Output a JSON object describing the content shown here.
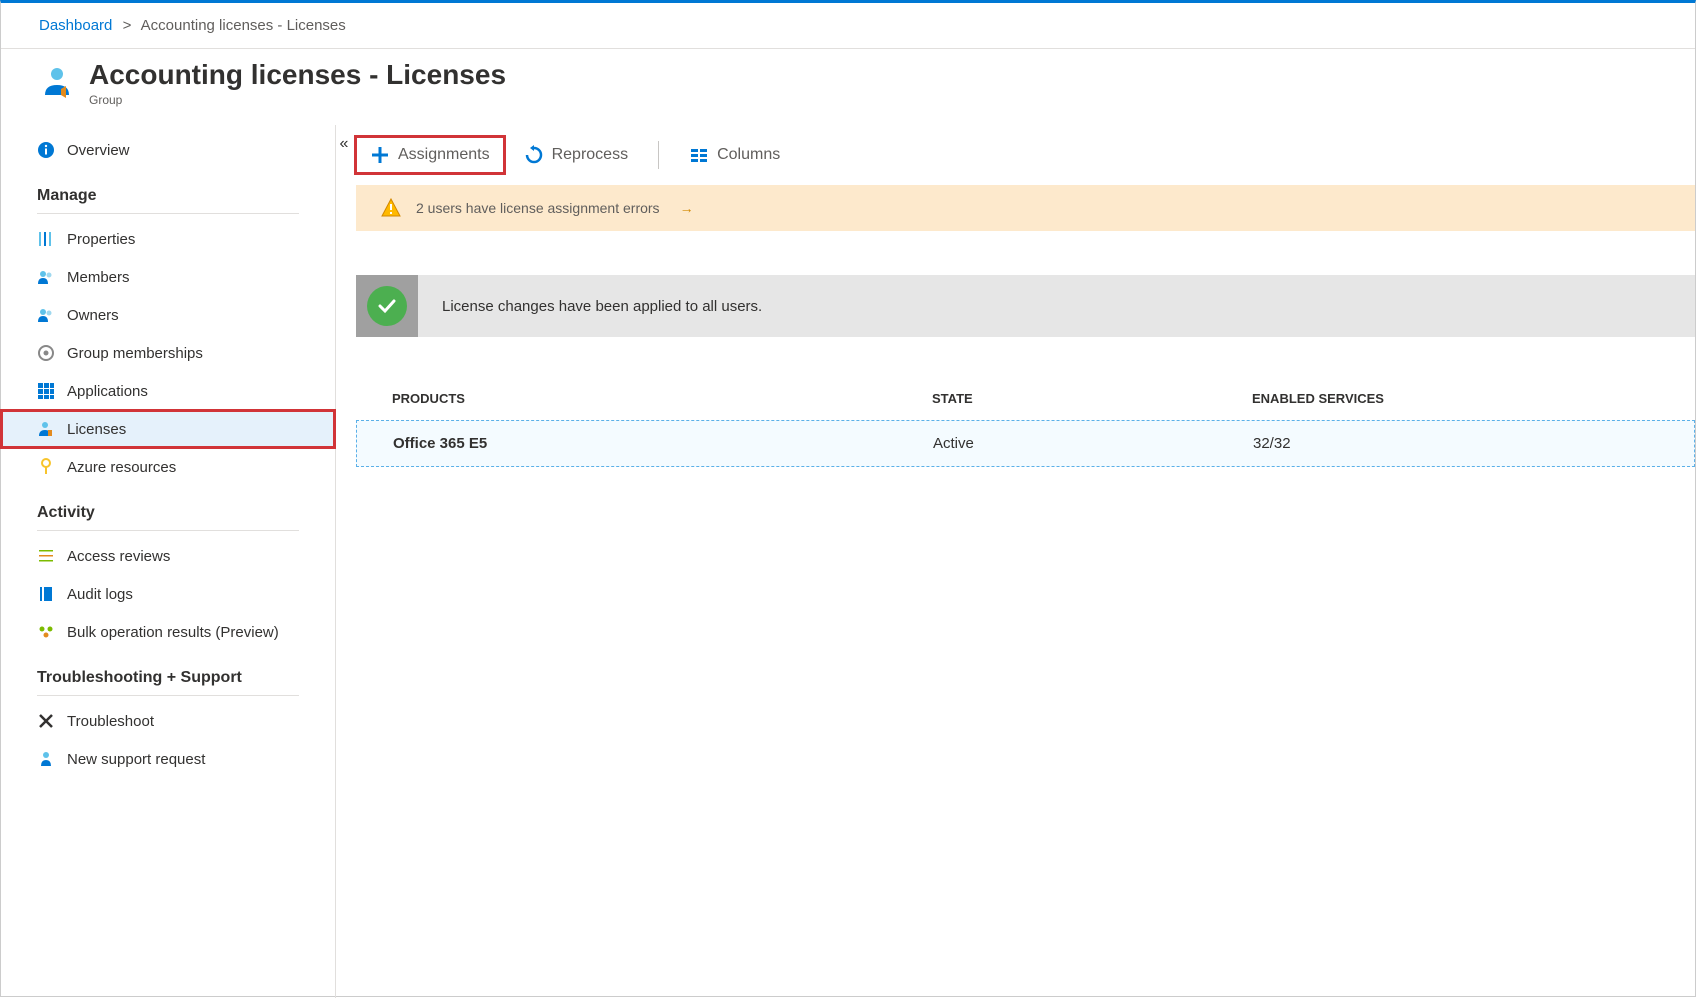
{
  "breadcrumb": {
    "root": "Dashboard",
    "current": "Accounting licenses - Licenses"
  },
  "header": {
    "title": "Accounting licenses - Licenses",
    "subtitle": "Group"
  },
  "sidebar": {
    "overview": "Overview",
    "sections": {
      "manage": "Manage",
      "activity": "Activity",
      "support": "Troubleshooting + Support"
    },
    "items": {
      "properties": "Properties",
      "members": "Members",
      "owners": "Owners",
      "group_memberships": "Group memberships",
      "applications": "Applications",
      "licenses": "Licenses",
      "azure_resources": "Azure resources",
      "access_reviews": "Access reviews",
      "audit_logs": "Audit logs",
      "bulk_ops": "Bulk operation results (Preview)",
      "troubleshoot": "Troubleshoot",
      "new_support": "New support request"
    }
  },
  "toolbar": {
    "assignments": "Assignments",
    "reprocess": "Reprocess",
    "columns": "Columns"
  },
  "warning": {
    "text": "2 users have license assignment errors"
  },
  "success": {
    "text": "License changes have been applied to all users."
  },
  "table": {
    "headers": {
      "products": "PRODUCTS",
      "state": "STATE",
      "enabled": "ENABLED SERVICES"
    },
    "rows": [
      {
        "product": "Office 365 E5",
        "state": "Active",
        "enabled": "32/32"
      }
    ]
  }
}
